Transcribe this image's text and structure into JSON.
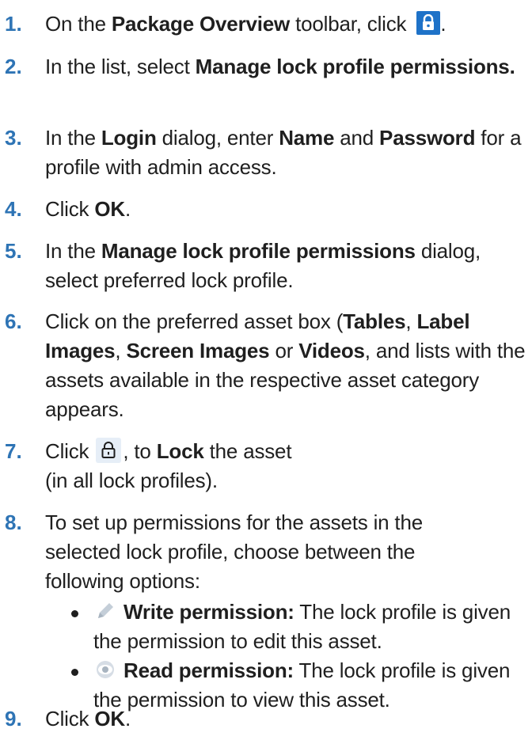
{
  "steps": [
    {
      "num": "1.",
      "a": "On the ",
      "b": "Package Overview",
      "c": " toolbar, click ",
      "d": "."
    },
    {
      "num": "2.",
      "a": "In the list, select ",
      "b": "Manage lock profile permissions."
    },
    {
      "num": "3.",
      "a": "In the ",
      "b": "Login",
      "c": " dialog, enter ",
      "d": "Name",
      "e": " and ",
      "f": "Password",
      "g": " for a profile with admin access."
    },
    {
      "num": "4.",
      "a": "Click ",
      "b": "OK",
      "c": "."
    },
    {
      "num": "5.",
      "a": "In the ",
      "b": "Manage lock profile permissions",
      "c": " dialog, select preferred lock profile."
    },
    {
      "num": "6.",
      "a": "Click on the preferred asset box (",
      "b": "Tables",
      "c": ", ",
      "d": "Label Images",
      "e": ", ",
      "f": "Screen Images",
      "g": " or ",
      "h": "Videos",
      "i": ", and lists with the assets available in the respective asset category appears."
    },
    {
      "num": "7.",
      "a": "Click ",
      "b": ", to ",
      "c": "Lock",
      "d": " the asset",
      "e": "(in all lock profiles)."
    },
    {
      "num": "8.",
      "a": "To set up permissions for the assets in the selected lock profile, choose between the following options:"
    },
    {
      "num": "9.",
      "a": "Click ",
      "b": "OK",
      "c": "."
    }
  ],
  "bullets": [
    {
      "label": "Write permission:",
      "text": " The lock profile is given the permission to edit this asset."
    },
    {
      "label": "Read permission:",
      "text": " The lock profile is given the permission to view this asset."
    }
  ],
  "icons": {
    "toolbar_lock": "lock-icon",
    "asset_lock": "lock-outline-icon",
    "write": "pencil-icon",
    "read": "eye-icon"
  },
  "colors": {
    "step_number": "#2e74b5",
    "lock_button": "#1e72c8"
  }
}
